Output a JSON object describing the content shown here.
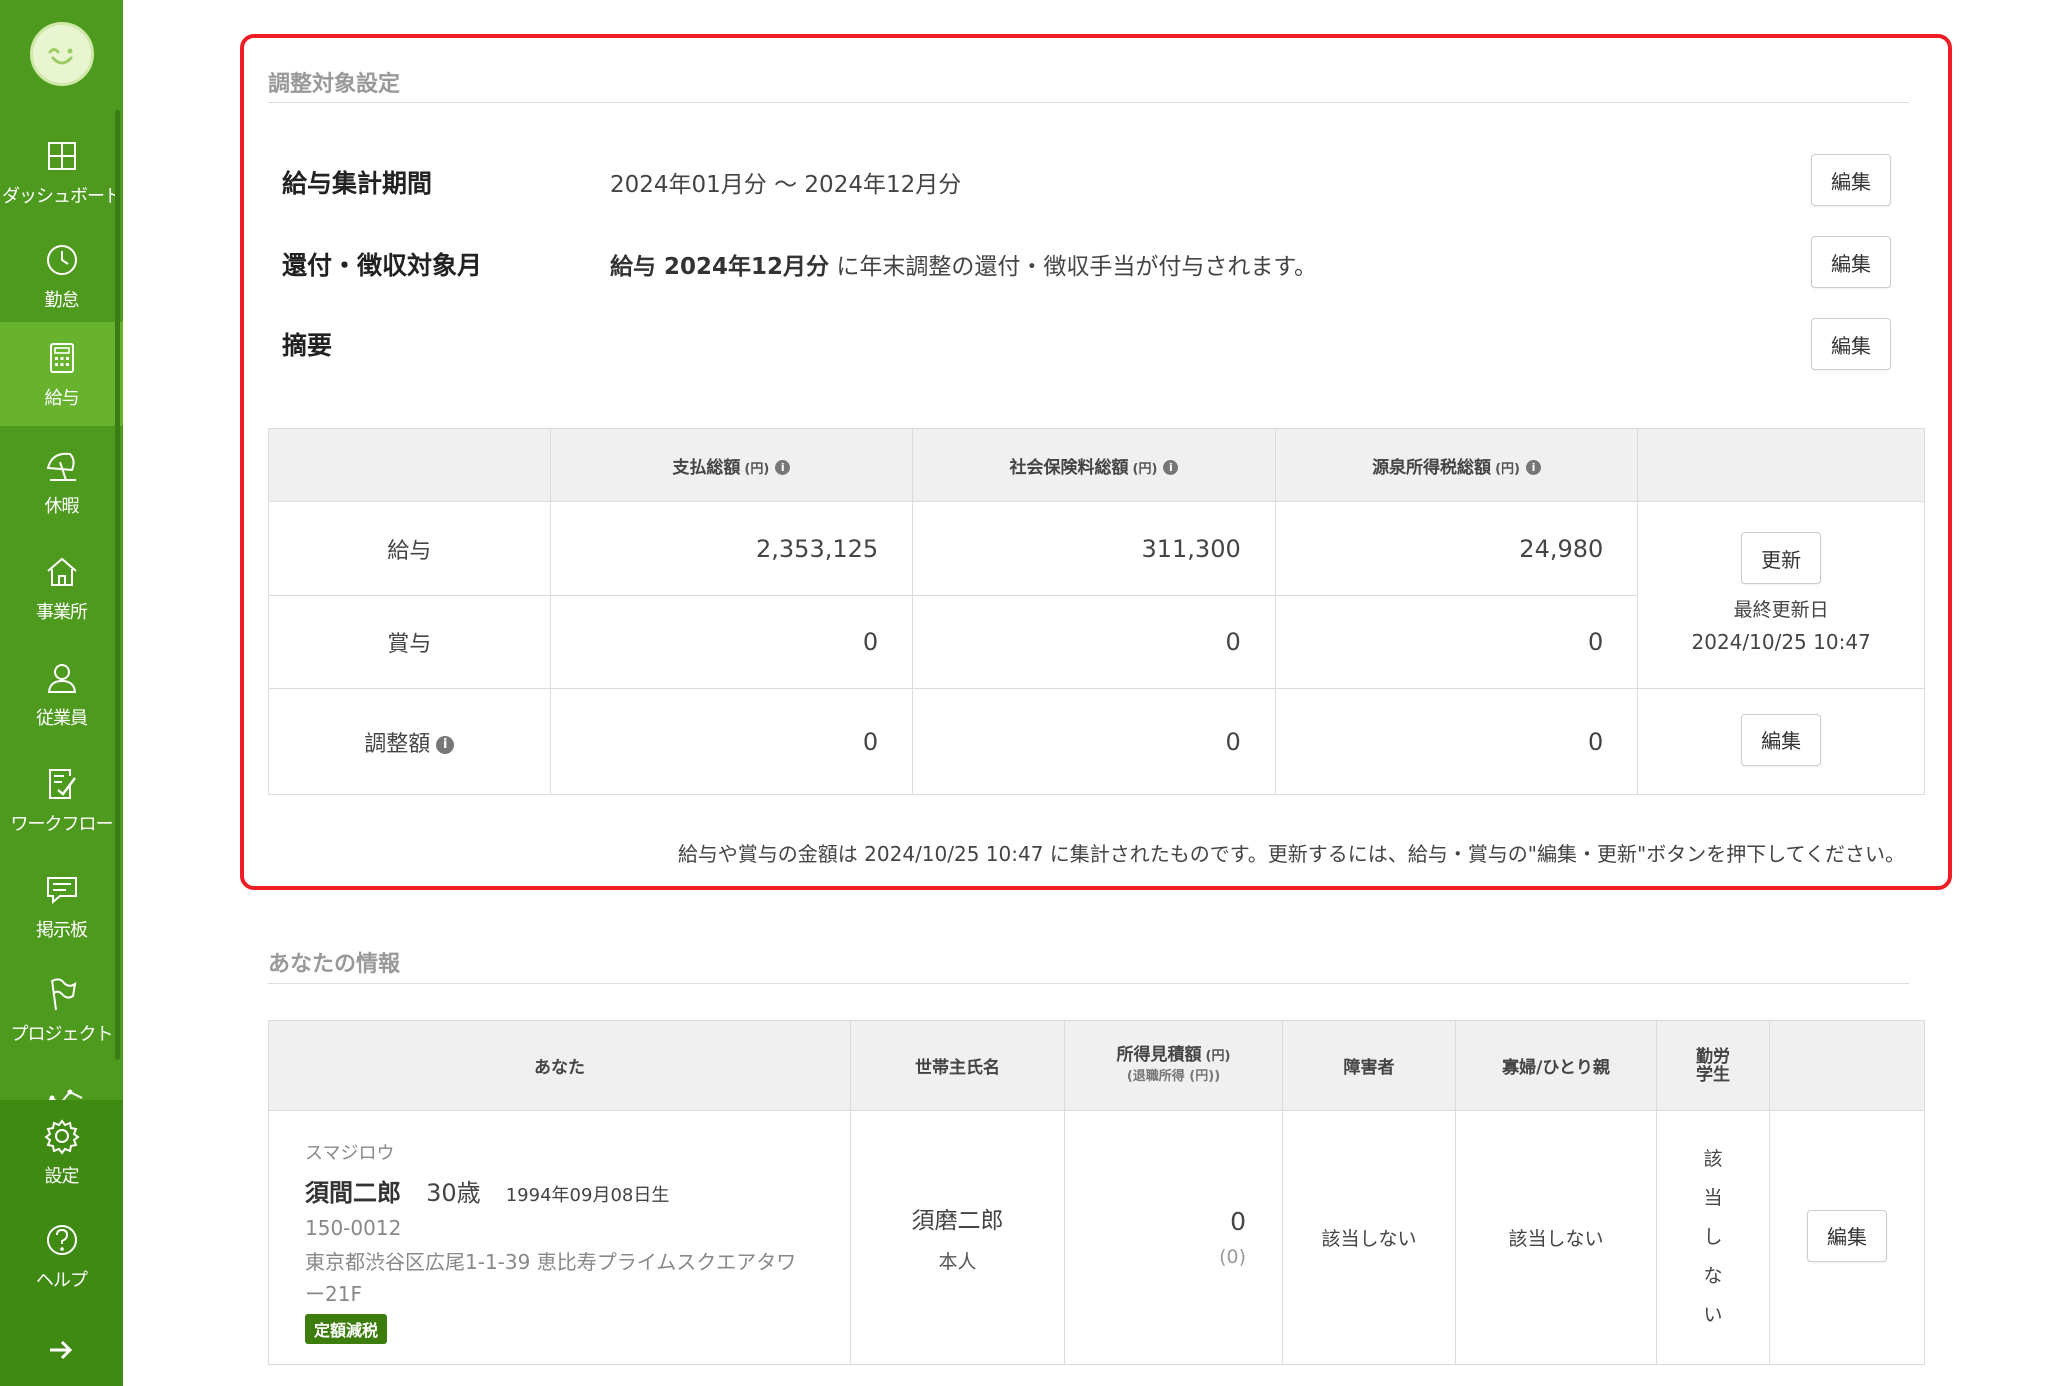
{
  "sidebar": {
    "items": [
      {
        "label": "ダッシュボード",
        "icon": "dashboard-icon"
      },
      {
        "label": "勤怠",
        "icon": "clock-icon"
      },
      {
        "label": "給与",
        "icon": "calculator-icon",
        "active": true
      },
      {
        "label": "休暇",
        "icon": "beach-umbrella-icon"
      },
      {
        "label": "事業所",
        "icon": "home-icon"
      },
      {
        "label": "従業員",
        "icon": "person-icon"
      },
      {
        "label": "ワークフロー",
        "icon": "checklist-icon"
      },
      {
        "label": "掲示板",
        "icon": "chat-icon"
      },
      {
        "label": "プロジェクト",
        "icon": "flag-icon"
      }
    ],
    "bottom_items": [
      {
        "label": "設定",
        "icon": "gear-icon"
      },
      {
        "label": "ヘルプ",
        "icon": "help-icon"
      }
    ]
  },
  "adjust": {
    "title": "調整対象設定",
    "period_label": "給与集計期間",
    "period_value": "2024年01月分 〜 2024年12月分",
    "refund_label": "還付・徴収対象月",
    "refund_bold": "給与 2024年12月分",
    "refund_rest": " に年末調整の還付・徴収手当が付与されます。",
    "summary_label": "摘要",
    "edit_label": "編集",
    "table": {
      "headers": [
        "支払総額",
        "社会保険料総額",
        "源泉所得税総額"
      ],
      "unit": "(円)",
      "rows": [
        {
          "label": "給与",
          "values": [
            "2,353,125",
            "311,300",
            "24,980"
          ]
        },
        {
          "label": "賞与",
          "values": [
            "0",
            "0",
            "0"
          ]
        },
        {
          "label": "調整額",
          "values": [
            "0",
            "0",
            "0"
          ]
        }
      ],
      "update_label": "更新",
      "last_updated_label": "最終更新日",
      "last_updated_value": "2024/10/25 10:47"
    },
    "note": "給与や賞与の金額は 2024/10/25 10:47 に集計されたものです。更新するには、給与・賞与の\"編集・更新\"ボタンを押下してください。"
  },
  "you": {
    "title": "あなたの情報",
    "headers": {
      "you": "あなた",
      "householder": "世帯主氏名",
      "income": "所得見積額",
      "income_unit": "(円)",
      "income_sub": "(退職所得 (円))",
      "disabled": "障害者",
      "widow": "寡婦/ひとり親",
      "student_1": "勤労",
      "student_2": "学生"
    },
    "kana": "スマジロウ",
    "name": "須間二郎",
    "age": "30歳",
    "birth": "1994年09月08日生",
    "zip": "150-0012",
    "address": "東京都渋谷区広尾1-1-39 恵比寿プライムスクエアタワー21F",
    "badge": "定額減税",
    "householder_name": "須磨二郎",
    "householder_rel": "本人",
    "income_value": "0",
    "retire_value": "(0)",
    "disabled_value": "該当しない",
    "widow_value": "該当しない",
    "student_value": [
      "該",
      "当",
      "し",
      "な",
      "い"
    ],
    "edit_label": "編集"
  }
}
